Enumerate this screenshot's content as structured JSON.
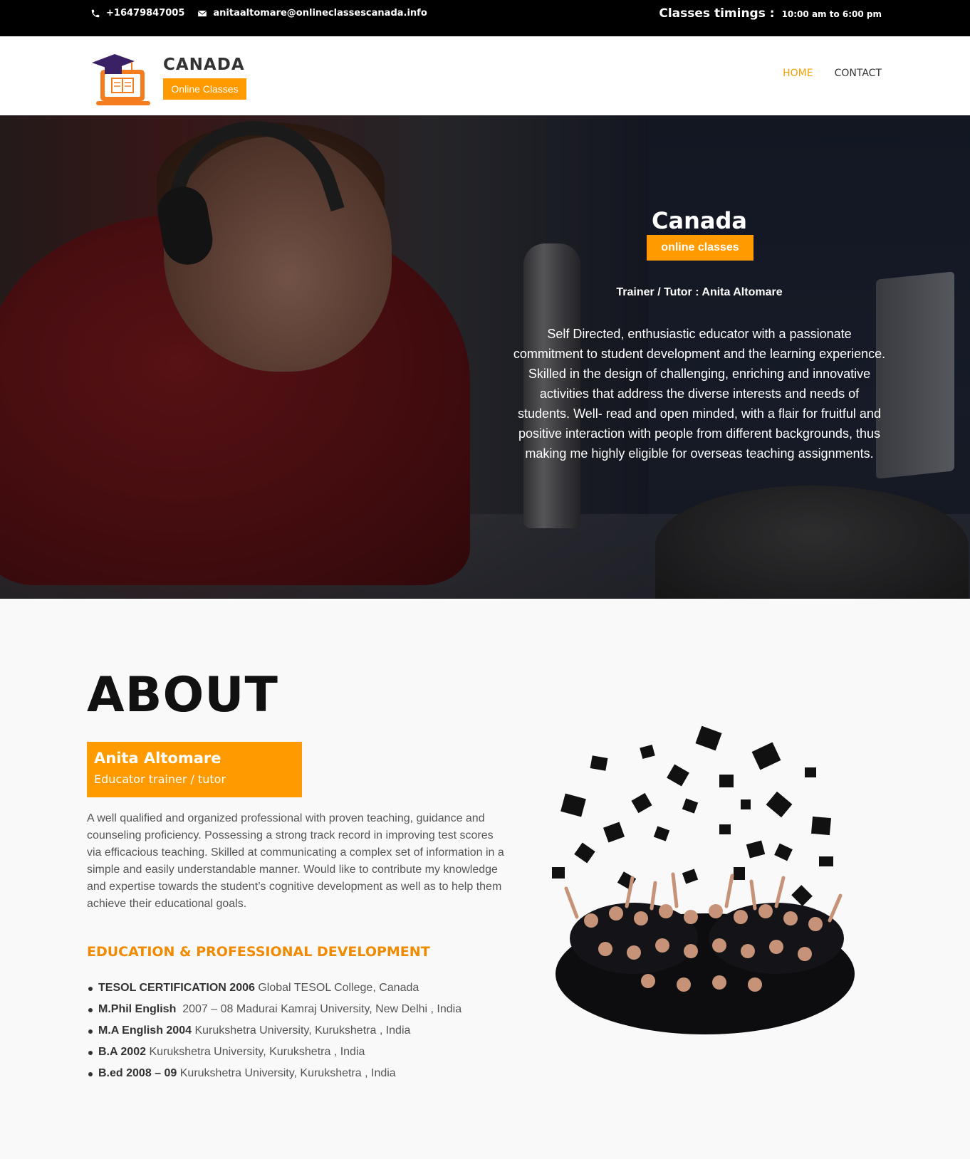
{
  "topbar": {
    "phone": "+16479847005",
    "email": "anitaaltomare@onlineclassescanada.info",
    "timings_label": "Classes timings :",
    "timings_value": "10:00 am to 6:00 pm"
  },
  "brand": {
    "name": "CANADA",
    "tag": "Online Classes"
  },
  "nav": {
    "items": [
      {
        "label": "HOME",
        "active": true
      },
      {
        "label": "CONTACT",
        "active": false
      }
    ]
  },
  "hero": {
    "title": "Canada",
    "badge": "online classes",
    "trainer": "Trainer / Tutor : Anita Altomare",
    "description": "Self Directed, enthusiastic educator with a passionate commitment to student development and the learning experience. Skilled in the design of challenging, enriching and innovative activities that address the diverse interests and needs of students. Well- read and open minded, with a flair for fruitful and positive interaction with people from different backgrounds, thus making me highly eligible for overseas teaching assignments."
  },
  "about": {
    "title": "ABOUT",
    "name": "Anita Altomare",
    "role": "Educator trainer / tutor",
    "text": "A well qualified and organized professional with proven teaching, guidance and counseling proficiency. Possessing a strong track record in improving test scores via efficacious teaching. Skilled at communicating a complex set of information in a simple and easily understandable manner. Would like to contribute my knowledge and expertise towards the student’s cognitive development as well as to help them achieve their educational goals.",
    "education_title": "EDUCATION & PROFESSIONAL DEVELOPMENT",
    "education": [
      {
        "degree": "TESOL CERTIFICATION 2006",
        "detail": "Global TESOL College, Canada"
      },
      {
        "degree": "M.Phil English",
        "detail": "2007 – 08 Madurai Kamraj University, New Delhi , India"
      },
      {
        "degree": "M.A English 2004",
        "detail": "Kurukshetra University, Kurukshetra , India"
      },
      {
        "degree": "B.A 2002",
        "detail": "Kurukshetra University, Kurukshetra , India"
      },
      {
        "degree": "B.ed 2008 – 09",
        "detail": "Kurukshetra University, Kurukshetra , India"
      }
    ]
  },
  "colors": {
    "accent": "#ff9a00",
    "nav_active": "#f5a100",
    "topbar_bg": "#000000"
  },
  "icons": [
    "phone-icon",
    "envelope-icon",
    "logo-laptop-book-icon"
  ]
}
